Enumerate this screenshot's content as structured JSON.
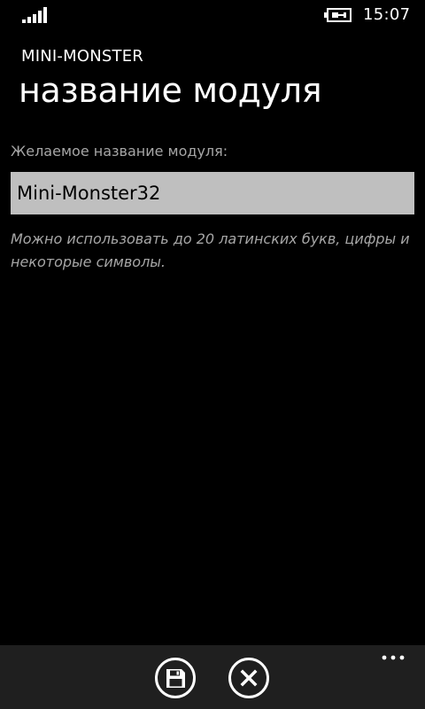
{
  "status_bar": {
    "signal_icon": "signal-bars-icon",
    "battery_icon": "battery-charging-icon",
    "time": "15:07"
  },
  "header": {
    "app_title": "MINI-MONSTER",
    "page_title": "название модуля"
  },
  "form": {
    "label": "Желаемое название модуля:",
    "input_value": "Mini-Monster32",
    "hint": "Можно использовать до 20 латинских букв, цифры и некоторые символы."
  },
  "app_bar": {
    "save_icon": "floppy-save-icon",
    "cancel_icon": "close-icon",
    "more_icon": "ellipsis-icon"
  },
  "colors": {
    "background": "#000000",
    "foreground": "#ffffff",
    "subtle_text": "#a6a6a6",
    "input_background": "#bfbfbf",
    "app_bar_background": "#1f1f1f"
  }
}
